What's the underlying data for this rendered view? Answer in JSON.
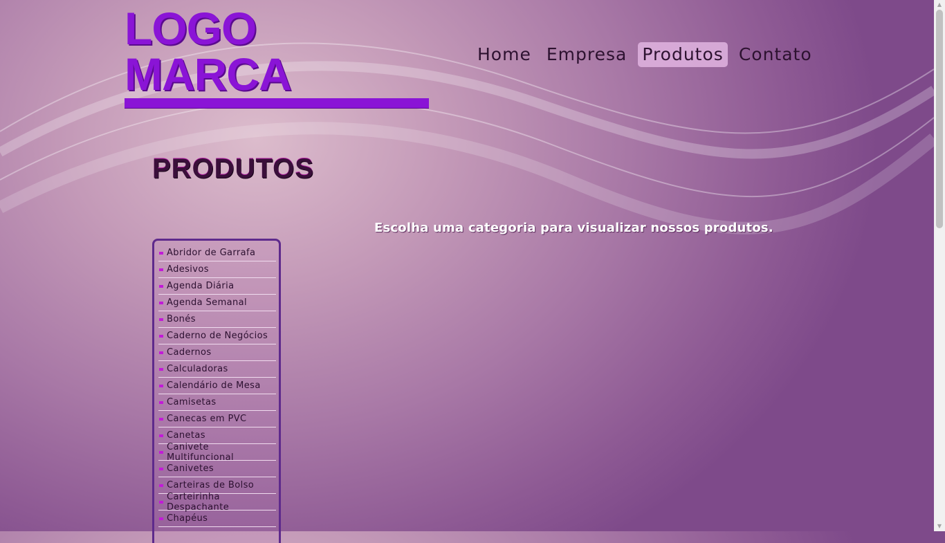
{
  "logo": {
    "text": "LOGO MARCA"
  },
  "nav": {
    "items": [
      {
        "label": "Home"
      },
      {
        "label": "Empresa"
      },
      {
        "label": "Produtos"
      },
      {
        "label": "Contato"
      }
    ],
    "active": "Produtos"
  },
  "page": {
    "title": "PRODUTOS",
    "intro": "Escolha uma categoria para visualizar nossos produtos."
  },
  "sidebar": {
    "categories": [
      "Abridor de Garrafa",
      "Adesivos",
      "Agenda Diária",
      "Agenda Semanal",
      "Bonés",
      "Caderno de Negócios",
      "Cadernos",
      "Calculadoras",
      "Calendário de Mesa",
      "Camisetas",
      "Canecas em PVC",
      "Canetas",
      "Canivete Multifuncional",
      "Canivetes",
      "Carteiras de Bolso",
      "Carteirinha Despachante",
      "Chapéus"
    ]
  },
  "colors": {
    "accent": "#8a14d6",
    "bullet": "#c21ad8",
    "sidebar_border": "#5e2a8c"
  },
  "icons": {
    "bullet": "square-bullet-icon",
    "scroll_up": "arrow-up-icon",
    "scroll_down": "arrow-down-icon"
  }
}
